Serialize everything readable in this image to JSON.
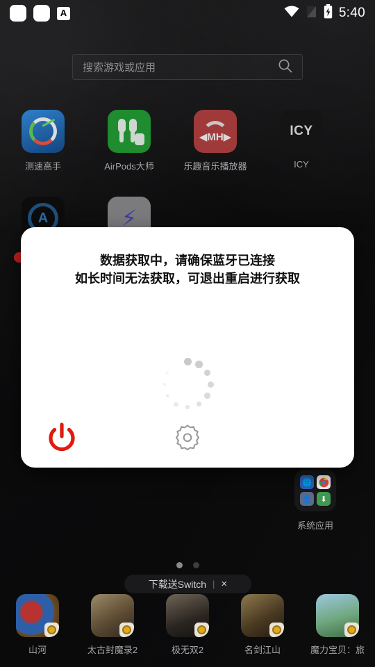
{
  "statusbar": {
    "notification_icons": [
      "notification-square-1",
      "notification-square-2"
    ],
    "letter_badge": "A",
    "right_icons": [
      "wifi-icon",
      "no-sim-icon",
      "battery-charging-icon"
    ],
    "time": "5:40"
  },
  "search": {
    "placeholder": "搜索游戏或应用",
    "icon": "search-icon"
  },
  "home": {
    "apps_row1": [
      {
        "label": "测速高手",
        "icon": "speedtest-icon"
      },
      {
        "label": "AirPods大师",
        "icon": "airpods-icon"
      },
      {
        "label": "乐趣音乐播放器",
        "icon": "music-player-icon"
      },
      {
        "label": "ICY",
        "icon": "icy-icon"
      }
    ],
    "apps_row2": [
      {
        "label": "",
        "icon": "ampere-icon"
      },
      {
        "label": "",
        "icon": "flash-icon"
      }
    ],
    "folder": {
      "label": "系统应用",
      "mini_icons": [
        "browser-icon",
        "chrome-icon",
        "contacts-icon",
        "downloads-icon"
      ]
    },
    "page_dots": {
      "count": 2,
      "active_index": 0
    },
    "banner": {
      "text": "下载送Switch",
      "separator": "|",
      "close": "×"
    },
    "dock": [
      {
        "label": "山河",
        "badge": "coin-badge"
      },
      {
        "label": "太古封魔录2",
        "badge": "coin-badge"
      },
      {
        "label": "极无双2",
        "badge": "coin-badge"
      },
      {
        "label": "名剑江山",
        "badge": "coin-badge"
      },
      {
        "label": "魔力宝贝：旅",
        "badge": "coin-badge"
      }
    ]
  },
  "dialog": {
    "line1": "数据获取中，请确保蓝牙已连接",
    "line2": "如长时间无法获取，可退出重启进行获取",
    "power_icon": "power-icon",
    "settings_icon": "gear-icon",
    "spinner": "loading-spinner",
    "power_color": "#e01b0f",
    "gear_color": "#9b9b9b"
  }
}
